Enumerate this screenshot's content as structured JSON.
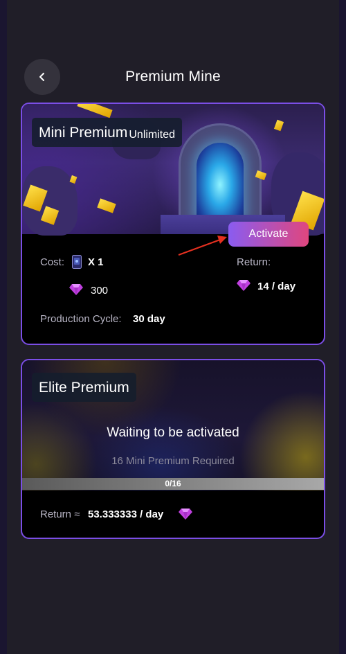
{
  "header": {
    "title": "Premium Mine",
    "back_icon": "chevron-left-icon"
  },
  "mini": {
    "title": "Mini Premium",
    "badge": "Unlimited",
    "activate_label": "Activate",
    "cost_label": "Cost:",
    "cost_ticket_qty": "X 1",
    "cost_gems": "300",
    "return_label": "Return:",
    "return_value": "14 / day",
    "cycle_label": "Production Cycle:",
    "cycle_value": "30 day"
  },
  "elite": {
    "title": "Elite Premium",
    "status": "Waiting to be activated",
    "requirement": "16 Mini Premium Required",
    "progress_text": "0/16",
    "progress_fraction": 0,
    "return_label": "Return ≈",
    "return_value": "53.333333 / day"
  },
  "colors": {
    "accent": "#7b4ee6",
    "activate_start": "#8a5cf0",
    "activate_end": "#e0467e",
    "arrow": "#e53020",
    "gem": "#c040e0"
  }
}
